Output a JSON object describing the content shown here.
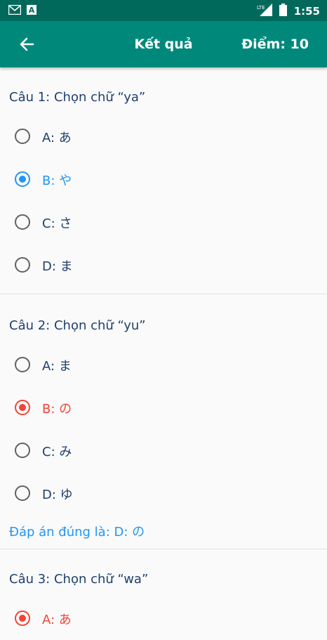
{
  "status_bar": {
    "time": "1:55",
    "icons": [
      "gmail-icon",
      "a-icon",
      "lte-signal-icon",
      "battery-icon"
    ]
  },
  "app_bar": {
    "title": "Kết quả",
    "score": "Điểm: 10",
    "back_icon": "arrow-back-icon"
  },
  "colors": {
    "status_bar": "#00695c",
    "app_bar": "#00897b",
    "question_text": "#1f3f6d",
    "selected_correct": "#2196f3",
    "selected_wrong": "#f44336"
  },
  "questions": [
    {
      "title": "Câu 1: Chọn chữ  “ya”",
      "options": [
        {
          "label": "A: あ",
          "state": "unselected"
        },
        {
          "label": "B: や",
          "state": "selected-correct"
        },
        {
          "label": "C: さ",
          "state": "unselected"
        },
        {
          "label": "D: ま",
          "state": "unselected"
        }
      ],
      "answer": ""
    },
    {
      "title": "Câu 2: Chọn chữ  “yu”",
      "options": [
        {
          "label": "A: ま",
          "state": "unselected"
        },
        {
          "label": "B: の",
          "state": "selected-wrong"
        },
        {
          "label": "C: み",
          "state": "unselected"
        },
        {
          "label": "D: ゆ",
          "state": "unselected"
        }
      ],
      "answer": "Đáp án đúng là: D: の"
    },
    {
      "title": "Câu 3: Chọn chữ  “wa”",
      "options": [
        {
          "label": "A: あ",
          "state": "selected-wrong"
        }
      ],
      "answer": ""
    }
  ]
}
